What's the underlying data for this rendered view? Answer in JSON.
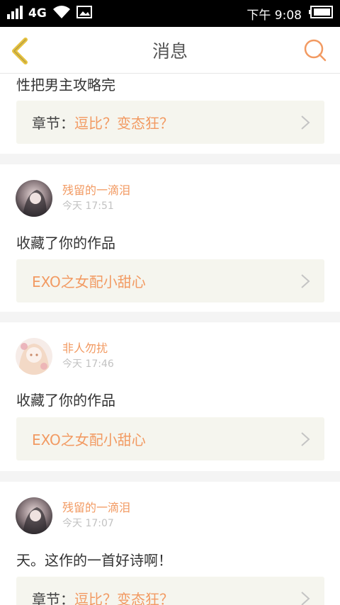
{
  "status_bar": {
    "network": "4G",
    "time": "下午 9:08"
  },
  "nav": {
    "title": "消息",
    "back_icon": "chevron-left-icon",
    "search_icon": "search-icon"
  },
  "colors": {
    "accent": "#f29a62",
    "back_icon": "#e6c23e",
    "ref_bg": "#f5f5ee"
  },
  "items": [
    {
      "message": "性把男主攻略完",
      "ref_label": "章节：",
      "ref_title": "逗比？变态狂？"
    },
    {
      "username": "残留的一滴泪",
      "time": "今天 17:51",
      "message": "收藏了你的作品",
      "ref_label": "",
      "ref_title": "EXO之女配小甜心"
    },
    {
      "username": "非人勿扰",
      "time": "今天 17:46",
      "message": "收藏了你的作品",
      "ref_label": "",
      "ref_title": "EXO之女配小甜心"
    },
    {
      "username": "残留的一滴泪",
      "time": "今天 17:07",
      "message": "天。这作的一首好诗啊！",
      "ref_label": "章节：",
      "ref_title": "逗比？变态狂？"
    }
  ]
}
